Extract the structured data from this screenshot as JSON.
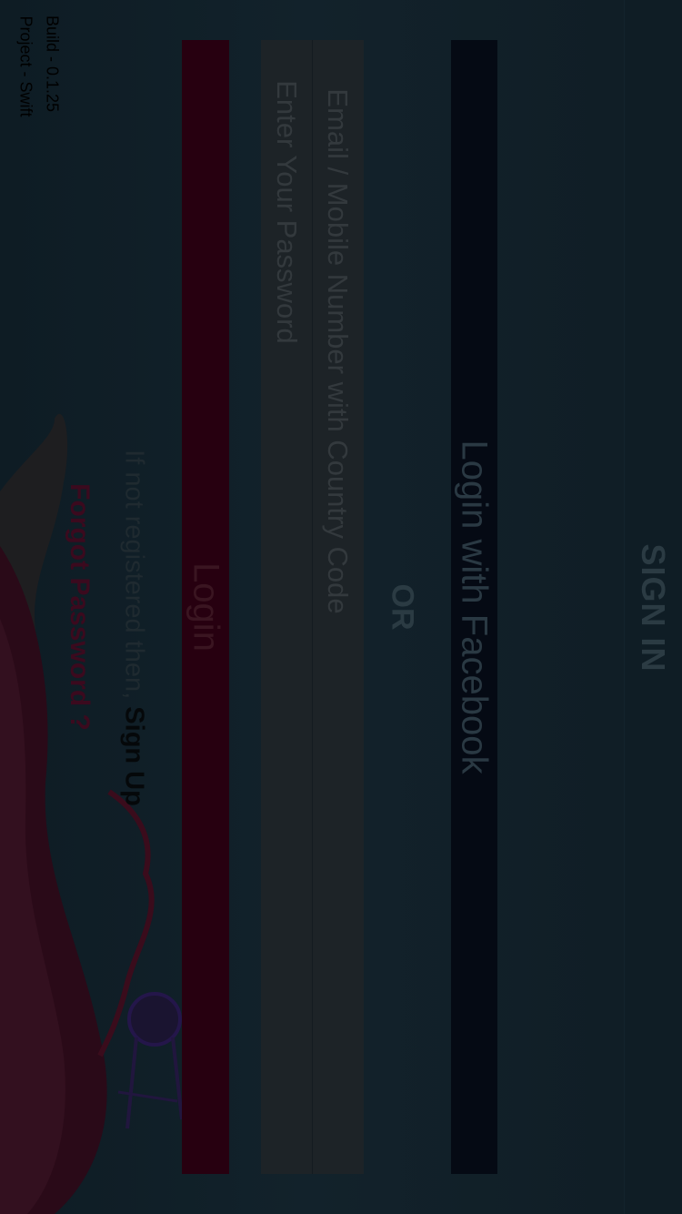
{
  "header": {
    "title": "SIGN IN"
  },
  "facebook_login": {
    "label": "Login with Facebook"
  },
  "divider": {
    "label": "OR"
  },
  "form": {
    "email": {
      "value": "",
      "placeholder": "Email / Mobile Number with Country Code"
    },
    "password": {
      "value": "",
      "placeholder": "Enter Your Password"
    },
    "login_label": "Login"
  },
  "signup": {
    "prompt": "If not registered then, ",
    "link_label": "Sign Up"
  },
  "forgot_password": {
    "label": "Forgot Password ?"
  },
  "footer": {
    "build": "Build - 0.1.25",
    "project": "Project - Swift"
  },
  "colors": {
    "overlay": "#0d1a22",
    "facebook_button": "#050a14",
    "login_button": "#270010",
    "input_field": "#1d2327",
    "forgot_password": "#3b0a1e"
  },
  "icons": {
    "illustration": "hot-air-balloon-illustration"
  }
}
